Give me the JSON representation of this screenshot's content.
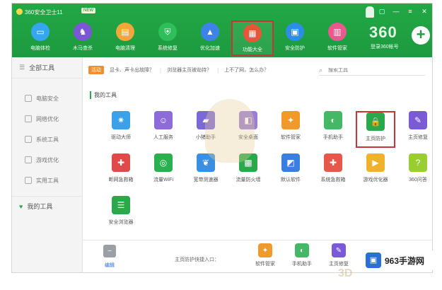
{
  "app": {
    "title": "360安全卫士11",
    "badge": "NEW",
    "window_controls": [
      "skin-icon",
      "minimize-icon",
      "menu-icon",
      "close-icon"
    ]
  },
  "nav": {
    "items": [
      {
        "label": "电脑体检",
        "icon": "monitor-icon",
        "color": "#35a6f0"
      },
      {
        "label": "木马查杀",
        "icon": "horse-icon",
        "color": "#7b57d6"
      },
      {
        "label": "电脑清理",
        "icon": "broom-icon",
        "color": "#f1a83a"
      },
      {
        "label": "系统修复",
        "icon": "shield-icon",
        "color": "#2fbf5a"
      },
      {
        "label": "优化加速",
        "icon": "rocket-icon",
        "color": "#3e84e8"
      },
      {
        "label": "功能大全",
        "icon": "grid-icon",
        "color": "#e8563a"
      },
      {
        "label": "安全防护",
        "icon": "wallet-icon",
        "color": "#2d8de8"
      },
      {
        "label": "软件管家",
        "icon": "apps-icon",
        "color": "#e85a8e"
      }
    ],
    "active_index": 5
  },
  "brand": {
    "logo_text": "360",
    "sub": "登录360帐号"
  },
  "sidebar": {
    "all_label": "全部工具",
    "items": [
      {
        "label": "电脑安全",
        "icon": "lock-icon"
      },
      {
        "label": "网络优化",
        "icon": "network-icon"
      },
      {
        "label": "系统工具",
        "icon": "gear-icon"
      },
      {
        "label": "游戏优化",
        "icon": "gamepad-icon"
      },
      {
        "label": "实用工具",
        "icon": "tool-icon"
      }
    ],
    "mine_label": "我的工具"
  },
  "notice": {
    "tag": "活动",
    "links": [
      "显卡、声卡出故障？",
      "浏览器主页被劫持？",
      "上不了网，怎么办？"
    ]
  },
  "search": {
    "placeholder": "搜索工具"
  },
  "section": {
    "title": "我的工具"
  },
  "tools": [
    {
      "label": "驱动大师",
      "icon": "chip-icon",
      "color": "#3aa0e8"
    },
    {
      "label": "人工服务",
      "icon": "service-icon",
      "color": "#8d6bd8"
    },
    {
      "label": "小猪助手",
      "icon": "truck-icon",
      "color": "#7c69d8"
    },
    {
      "label": "安全桌面",
      "icon": "desktop-icon",
      "color": "#9a7fd6"
    },
    {
      "label": "软件管家",
      "icon": "pinwheel-icon",
      "color": "#f09a2c"
    },
    {
      "label": "手机助手",
      "icon": "phone-icon",
      "color": "#45b865"
    },
    {
      "label": "主页防护",
      "icon": "lock-icon",
      "color": "#2aa84a"
    },
    {
      "label": "主页修复",
      "icon": "wrench-icon",
      "color": "#7a5ad6"
    },
    {
      "label": "断网急救箱",
      "icon": "firstaid-icon",
      "color": "#e04a4a"
    },
    {
      "label": "流量WiFi",
      "icon": "wifi-icon",
      "color": "#2bb050"
    },
    {
      "label": "宽带测速器",
      "icon": "lungs-icon",
      "color": "#3a8fe0"
    },
    {
      "label": "流量防火墙",
      "icon": "firewall-icon",
      "color": "#2aa84a"
    },
    {
      "label": "默认软件",
      "icon": "default-icon",
      "color": "#3a7fe0"
    },
    {
      "label": "系统急救箱",
      "icon": "rescue-icon",
      "color": "#e6594a"
    },
    {
      "label": "游戏优化器",
      "icon": "game-icon",
      "color": "#f0b12c"
    },
    {
      "label": "360问答",
      "icon": "question-icon",
      "color": "#9acd32"
    },
    {
      "label": "安全浏览器",
      "icon": "browser-icon",
      "color": "#2aa84a"
    }
  ],
  "highlight_index": 6,
  "bottom": {
    "tool": {
      "label": "编辑",
      "icon": "remove-icon"
    },
    "entry": "主页防护快捷入口：",
    "quick": [
      {
        "label": "软件管家",
        "icon": "pinwheel-icon",
        "color": "#f09a2c"
      },
      {
        "label": "手机助手",
        "icon": "phone-icon",
        "color": "#45b865"
      },
      {
        "label": "主页修复",
        "icon": "wrench-icon",
        "color": "#7a5ad6"
      }
    ]
  },
  "watermark": {
    "text": "963手游网",
    "sub": "3D"
  }
}
